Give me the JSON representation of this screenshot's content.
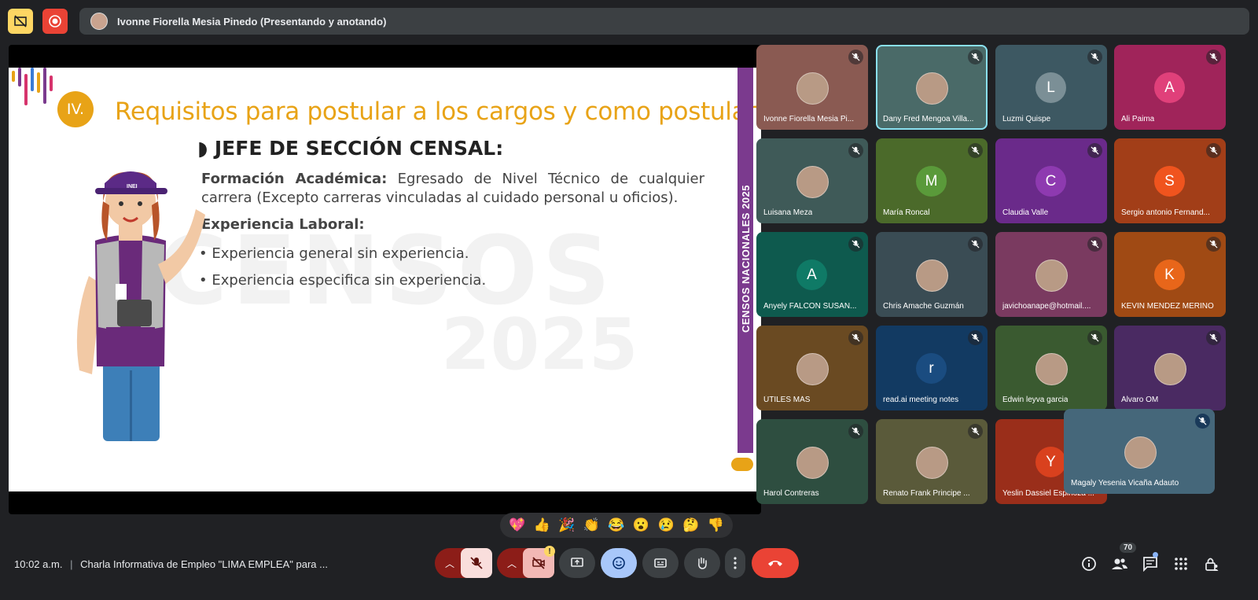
{
  "presenter_bar": {
    "label": "Ivonne Fiorella Mesia Pinedo (Presentando y anotando)"
  },
  "slide": {
    "section_number": "IV.",
    "title": "Requisitos para postular a los cargos y como postular. (cont.)",
    "heading": "◗ JEFE DE SECCIÓN CENSAL:",
    "formacion_label": "Formación Académica:",
    "formacion_text": " Egresado de Nivel Técnico de cualquier carrera (Excepto carreras vinculadas al cuidado personal u oficios).",
    "experiencia_label": "Experiencia Laboral:",
    "bullets": [
      "• Experiencia general sin experiencia.",
      "• Experiencia especifica sin experiencia."
    ],
    "side_band_text": "CENSOS NACIONALES 2025",
    "watermark_line1": "CENSOS",
    "watermark_line2": "2025",
    "vest_logo": "INEI"
  },
  "participants": [
    {
      "name": "Ivonne Fiorella Mesia Pi...",
      "bg": "#8a5a52",
      "kind": "photo"
    },
    {
      "name": "Dany Fred Mengoa Villa...",
      "bg": "#4a6a68",
      "kind": "photo",
      "active": true
    },
    {
      "name": "Luzmi Quispe",
      "bg": "#3d5862",
      "kind": "letter",
      "letter": "L",
      "avatar_color": "#7b8f96"
    },
    {
      "name": "Ali Paima",
      "bg": "#a0245a",
      "kind": "letter",
      "letter": "A",
      "avatar_color": "#e0407a"
    },
    {
      "name": "Luisana Meza",
      "bg": "#3f5a58",
      "kind": "photo"
    },
    {
      "name": "María Roncal",
      "bg": "#4b6a2a",
      "kind": "letter",
      "letter": "M",
      "avatar_color": "#5a9a3a"
    },
    {
      "name": "Claudia Valle",
      "bg": "#6a2a8a",
      "kind": "letter",
      "letter": "C",
      "avatar_color": "#8e3ab0"
    },
    {
      "name": "Sergio antonio Fernand...",
      "bg": "#a23e18",
      "kind": "letter",
      "letter": "S",
      "avatar_color": "#f0541e"
    },
    {
      "name": "Anyely FALCON SUSAN...",
      "bg": "#0e5a4e",
      "kind": "letter",
      "letter": "A",
      "avatar_color": "#0f7a66"
    },
    {
      "name": "Chris Amache Guzmán",
      "bg": "#3a4c54",
      "kind": "photo"
    },
    {
      "name": "javichoanape@hotmail....",
      "bg": "#7a3a60",
      "kind": "photo"
    },
    {
      "name": "KEVIN MENDEZ MERINO",
      "bg": "#a04a14",
      "kind": "letter",
      "letter": "K",
      "avatar_color": "#e8661a"
    },
    {
      "name": "ÚTILES MÁS",
      "bg": "#6a4a22",
      "kind": "photo"
    },
    {
      "name": "read.ai meeting notes",
      "bg": "#123a62",
      "kind": "letter",
      "letter": "r",
      "avatar_color": "#1a4c80"
    },
    {
      "name": "Edwin leyva garcia",
      "bg": "#3a5a30",
      "kind": "photo"
    },
    {
      "name": "Álvaro OM",
      "bg": "#4a2a62",
      "kind": "photo"
    },
    {
      "name": "Harol Contreras",
      "bg": "#2e4e40",
      "kind": "photo"
    },
    {
      "name": "Renato Frank Principe ...",
      "bg": "#5a5a3a",
      "kind": "photo"
    },
    {
      "name": "Yeslin Dassiel Espinoza ...",
      "bg": "#9a2e1a",
      "kind": "letter",
      "letter": "Y",
      "avatar_color": "#d9411e"
    }
  ],
  "floating_tile": {
    "name": "Magaly Yesenia Vicaña Adauto",
    "bg": "#45677a"
  },
  "reactions": [
    "💖",
    "👍",
    "🎉",
    "👏",
    "😂",
    "😮",
    "😢",
    "🤔",
    "👎"
  ],
  "bottom_bar": {
    "time": "10:02 a.m.",
    "meeting_title": "Charla Informativa de Empleo \"LIMA EMPLEA\" para ...",
    "people_count": "70"
  },
  "colors": {
    "background": "#202124",
    "slide_accent": "#e8a317",
    "slide_band": "#7b3a8e",
    "end_call": "#ea4335",
    "mic_off": "#f9dedc"
  }
}
